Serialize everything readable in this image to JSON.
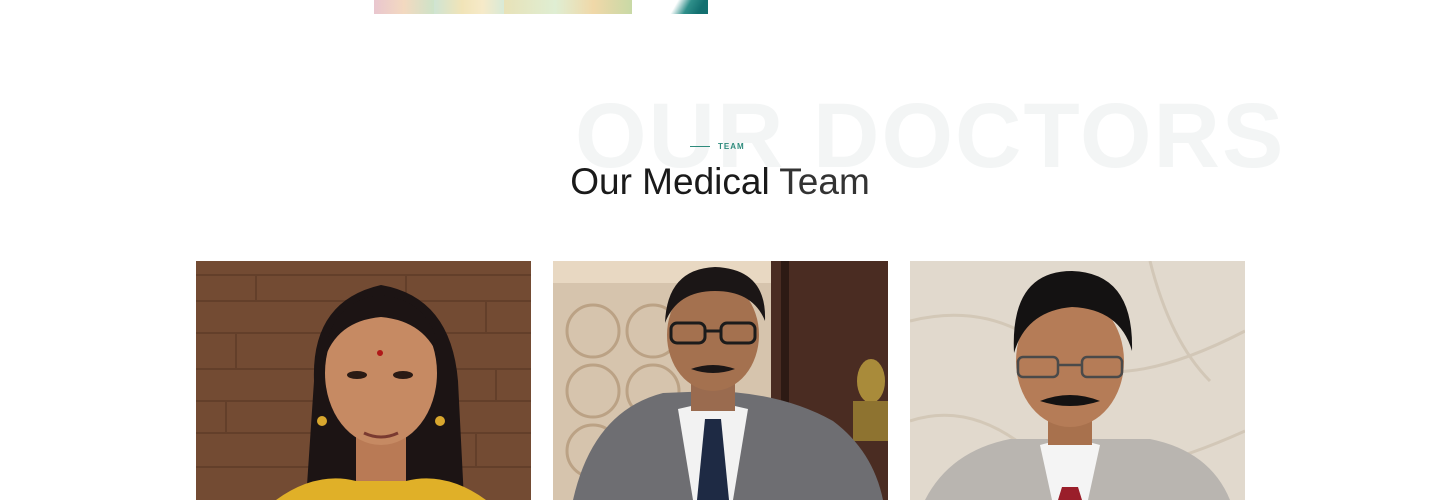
{
  "section": {
    "watermark": "OUR DOCTORS",
    "eyebrow": "TEAM",
    "title_strong": "Our Medical",
    "title_light": "Team"
  },
  "doctors": [
    {
      "photo": "female-doctor-photo"
    },
    {
      "photo": "male-doctor-suit-photo"
    },
    {
      "photo": "male-doctor-glasses-photo"
    }
  ],
  "colors": {
    "accent": "#2e8b7c",
    "heading": "#1a1a1a",
    "watermark": "#f3f5f5"
  }
}
